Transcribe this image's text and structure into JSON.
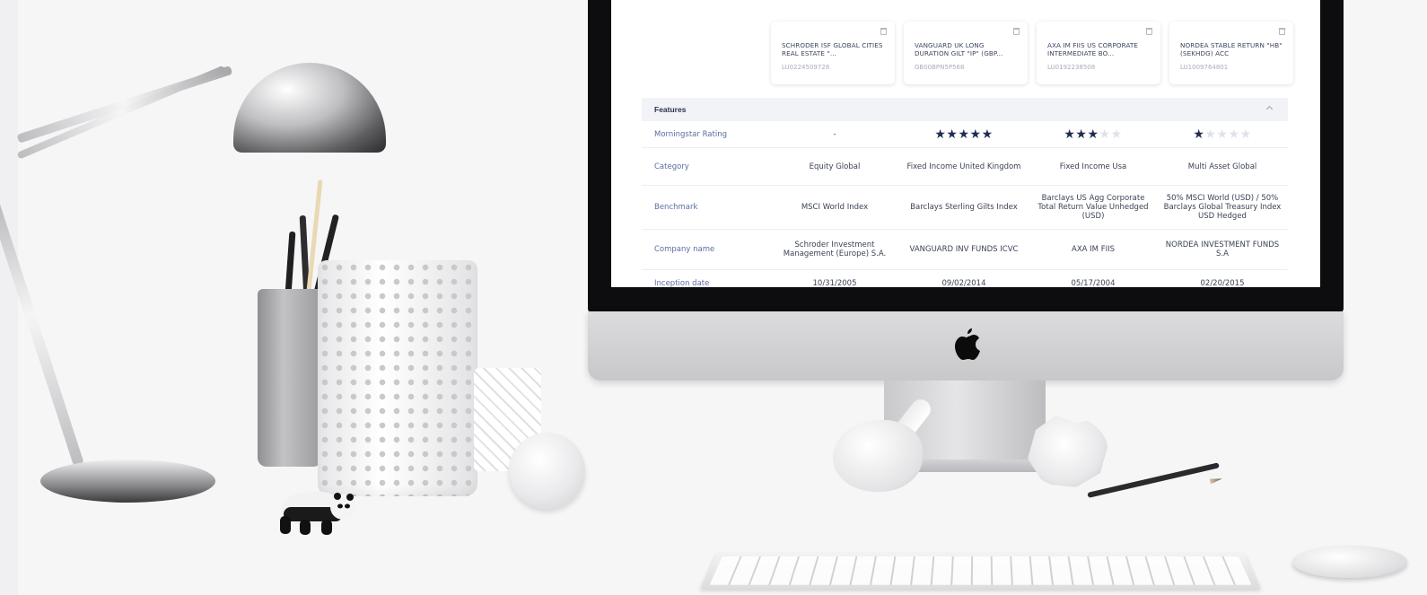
{
  "funds": [
    {
      "name": "SCHRODER ISF GLOBAL CITIES REAL ESTATE \"...",
      "isin": "LU0224509728"
    },
    {
      "name": "VANGUARD UK LONG DURATION GILT \"IP\" (GBP...",
      "isin": "GB00BPN5P568"
    },
    {
      "name": "AXA IM FIIS US CORPORATE INTERMEDIATE BO...",
      "isin": "LU0192238508"
    },
    {
      "name": "NORDEA STABLE RETURN \"HB\" (SEKHDG) ACC",
      "isin": "LU1009764801"
    }
  ],
  "section": {
    "title": "Features"
  },
  "rows": {
    "morningstar": {
      "label": "Morningstar Rating",
      "values": [
        "-",
        "",
        "",
        ""
      ],
      "ratings": [
        0,
        5,
        3,
        1
      ],
      "max_rating": 5
    },
    "category": {
      "label": "Category",
      "values": [
        "Equity Global",
        "Fixed Income United Kingdom",
        "Fixed Income Usa",
        "Multi Asset Global"
      ]
    },
    "benchmark": {
      "label": "Benchmark",
      "values": [
        "MSCI World Index",
        "Barclays Sterling Gilts Index",
        "Barclays US Agg Corporate Total Return Value Unhedged (USD)",
        "50% MSCI World (USD) / 50% Barclays Global Treasury Index USD Hedged"
      ]
    },
    "company": {
      "label": "Company name",
      "values": [
        "Schroder Investment Management (Europe) S.A.",
        "VANGUARD INV FUNDS ICVC",
        "AXA IM FIIS",
        "NORDEA INVESTMENT FUNDS S.A"
      ]
    },
    "inception": {
      "label": "Inception date",
      "values": [
        "10/31/2005",
        "09/02/2014",
        "05/17/2004",
        "02/20/2015"
      ]
    }
  },
  "colors": {
    "star_on": "#1f2b52",
    "star_off": "#dfe2ea",
    "label_text": "#5a6ea0",
    "header_bg": "#f2f3f6"
  },
  "icons": {
    "trash": "trash-icon",
    "collapse": "chevron-up-icon",
    "star": "star-icon"
  }
}
